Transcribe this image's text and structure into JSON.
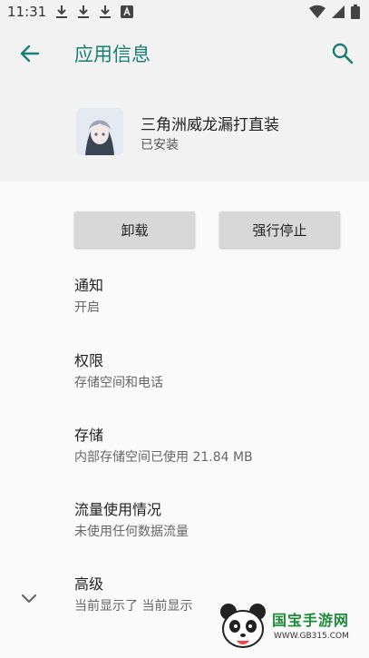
{
  "status_bar": {
    "time": "11:31",
    "notification_icons": [
      "download-icon",
      "download-icon",
      "download-icon",
      "a-icon"
    ],
    "system_icons": [
      "wifi-icon",
      "signal-icon",
      "battery-icon"
    ]
  },
  "app_bar": {
    "title": "应用信息",
    "back_icon": "arrow-left-icon",
    "search_icon": "search-icon",
    "accent_color": "#1a7f73"
  },
  "app": {
    "name": "三角洲威龙漏打直装",
    "status": "已安装"
  },
  "buttons": {
    "uninstall": "卸载",
    "force_stop": "强行停止"
  },
  "preferences": [
    {
      "title": "通知",
      "summary": "开启"
    },
    {
      "title": "权限",
      "summary": "存储空间和电话"
    },
    {
      "title": "存储",
      "summary": "内部存储空间已使用 21.84 MB"
    },
    {
      "title": "流量使用情况",
      "summary": "未使用任何数据流量"
    },
    {
      "title": "高级",
      "summary": "当前显示了 当前显示"
    }
  ],
  "watermark": {
    "text": "国宝手游网",
    "url": "WWW.GB315.COM"
  }
}
